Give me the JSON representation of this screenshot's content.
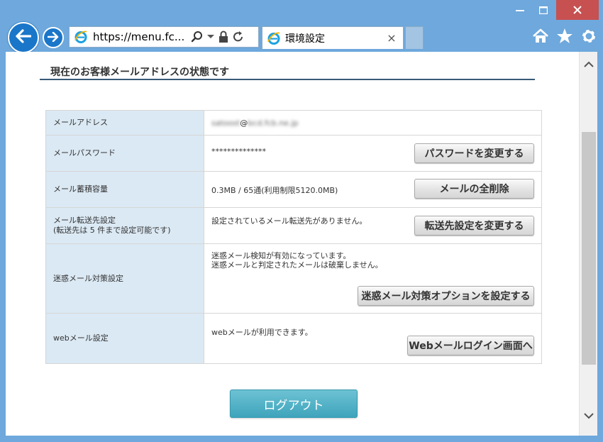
{
  "browser": {
    "address": "https://menu.fc...",
    "tab_title": "環境設定",
    "tab_close": "×"
  },
  "page": {
    "section_title": "現在のお客様メールアドレスの状態です",
    "rows": [
      {
        "label": "メールアドレス",
        "value_prefix": "satoost",
        "value_at": "@",
        "value_suffix": "bcd.fcb.ne.jp"
      },
      {
        "label": "メールパスワード",
        "value": "**************",
        "button": "パスワードを変更する"
      },
      {
        "label": "メール蓄積容量",
        "value": "0.3MB / 65通(利用制限5120.0MB)",
        "button": "メールの全削除"
      },
      {
        "label_line1": "メール転送先設定",
        "label_line2": "(転送先は 5 件まで設定可能です)",
        "value": "設定されているメール転送先がありません。",
        "button": "転送先設定を変更する"
      },
      {
        "label": "迷惑メール対策設定",
        "value_line1": "迷惑メール検知が有効になっています。",
        "value_line2": "迷惑メールと判定されたメールは破棄しません。",
        "button": "迷惑メール対策オプションを設定する"
      },
      {
        "label": "webメール設定",
        "value": "webメールが利用できます。",
        "button": "Webメールログイン画面へ"
      }
    ],
    "logout_label": "ログアウト"
  },
  "colors": {
    "frame": "#6ea8dc",
    "label_bg": "#dbe9f4",
    "logout_bg": "#4aaec4",
    "close_btn": "#c75050"
  },
  "icons": {
    "back": "back-arrow-icon",
    "forward": "forward-arrow-icon",
    "ie": "ie-logo-icon",
    "search": "search-icon",
    "dropdown": "chevron-down-icon",
    "lock": "lock-icon",
    "refresh": "refresh-icon",
    "home": "home-icon",
    "favorites": "star-icon",
    "settings": "gear-icon"
  }
}
